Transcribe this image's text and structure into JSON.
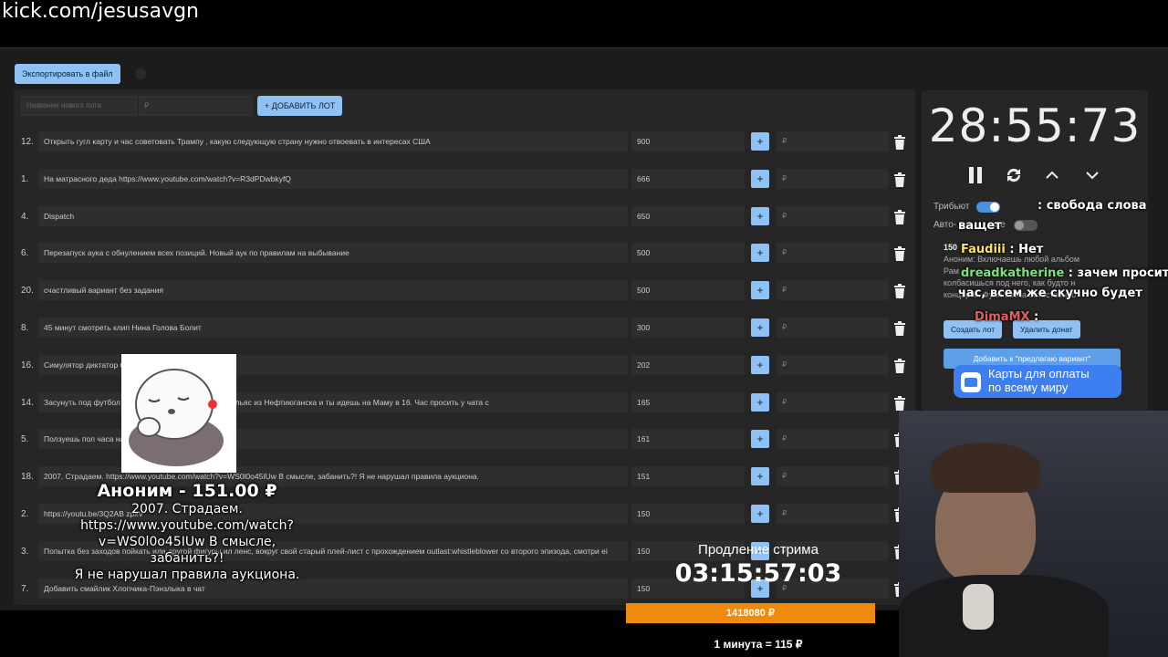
{
  "url": "kick.com/jesusavgn",
  "toolbar": {
    "export_label": "Экспортировать в файл"
  },
  "new_lot": {
    "name_placeholder": "Название нового лота",
    "price_placeholder": "₽",
    "add_label": "+ ДОБАВИТЬ ЛОТ"
  },
  "lots": [
    {
      "num": "12.",
      "name": "Открыть гугл карту и час советовать Трампу , какую следующую страну нужно отвоевать в интересах США",
      "amount": "900"
    },
    {
      "num": "1.",
      "name": "На матрасного деда https://www.youtube.com/watch?v=R3dPDwbkyfQ",
      "amount": "666"
    },
    {
      "num": "4.",
      "name": "Dispatch",
      "amount": "650"
    },
    {
      "num": "6.",
      "name": "Перезапуск аука с обнулением всех позиций. Новый аук по правилам на выбывание",
      "amount": "500"
    },
    {
      "num": "20.",
      "name": "счастливый вариант без задания",
      "amount": "500"
    },
    {
      "num": "8.",
      "name": "45 минут смотреть клип Нина Голова Болит",
      "amount": "300"
    },
    {
      "num": "16.",
      "name": "Симулятор диктатор 6",
      "amount": "202"
    },
    {
      "num": "14.",
      "name": "Засунуть под футбол , сказать что тебя обрюхатил Ильяс из Нефтиюганска и ты идешь на Маму в 16. Час просить у чата с",
      "amount": "165"
    },
    {
      "num": "5.",
      "name": "Ползуешь пол часа на нская Блядота",
      "amount": "161"
    },
    {
      "num": "18.",
      "name": "2007. Страдаем. https://www.youtube.com/watch?v=WS0l0o45IUw В смысле, забанить?! Я не нарушал правила аукциона.",
      "amount": "151"
    },
    {
      "num": "2.",
      "name": "https://youtu.be/3Q2AB zpxV",
      "amount": "150"
    },
    {
      "num": "3.",
      "name": "Попытка без заходов пойкать или другой фигуры ил ленс, вокруг свой старый плей-лист с прохождением outlast:whistleblower со второго эпизода, смотри ei",
      "amount": "150"
    },
    {
      "num": "7.",
      "name": "Добавить смайлик Хлопчика-Пэнзлыка в чат",
      "amount": "150"
    }
  ],
  "lot_row_labels": {
    "plus": "+",
    "ruble": "₽"
  },
  "timer": {
    "value": "28:55:73"
  },
  "toggles": {
    "tribute": "Трибьют",
    "auto": "Авто-",
    "auto_suffix": "ние"
  },
  "chat": [
    {
      "user": "",
      "text": ": свобода слова"
    },
    {
      "user": "",
      "text": "ващет"
    },
    {
      "user": "Faudiii",
      "text": " : Нет"
    },
    {
      "user": "dreadkatherine",
      "text": " : зачем просить"
    },
    {
      "user": "",
      "text": "час, всем же скучно будет"
    },
    {
      "user": "DimaMX",
      "text": " :"
    }
  ],
  "donate": {
    "amount": "150",
    "line1": "Аноним: Включаешь любой альбом",
    "line2": "Рам",
    "line3": "колбасишься под него, как будто н",
    "line4": "концерте. Фулл вебка естественно",
    "create_label": "Создать лот",
    "delete_label": "Удалить донат",
    "add_suggest_label": "Добавить к \"предлагаю вариант\"",
    "pay_banner": [
      "Карты для оплаты",
      "по всему миру"
    ]
  },
  "alert": {
    "title": "Аноним - 151.00 ₽",
    "lines": [
      "2007. Страдаем.",
      "https://www.youtube.com/watch?",
      "v=WS0l0o45IUw В смысле, забанить?!",
      "Я не нарушал правила аукциона."
    ]
  },
  "stream": {
    "label": "Продление стрима",
    "timer": "03:15:57:03",
    "progress_label": "1418080 ₽",
    "progress_fraction": 1.0,
    "rate": "1 минута = 115 ₽"
  },
  "colors": {
    "accent": "#8fc1f5",
    "progress": "#f08a0c",
    "banner": "#3d7ff0"
  }
}
